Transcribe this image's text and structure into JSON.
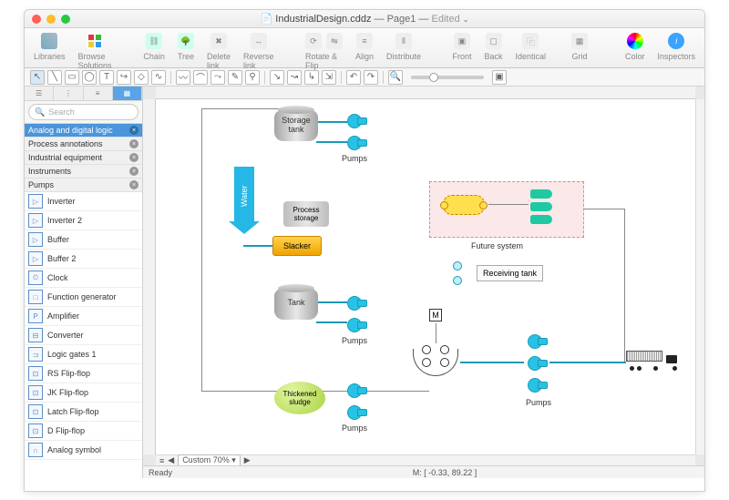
{
  "title": {
    "filename": "IndustrialDesign.cddz",
    "page": "Page1",
    "status": "Edited"
  },
  "toolbar": {
    "libraries": "Libraries",
    "browseSolutions": "Browse Solutions",
    "chain": "Chain",
    "tree": "Tree",
    "deleteLink": "Delete link",
    "reverseLink": "Reverse link",
    "rotateFlip": "Rotate & Flip",
    "align": "Align",
    "distribute": "Distribute",
    "front": "Front",
    "back": "Back",
    "identical": "Identical",
    "grid": "Grid",
    "color": "Color",
    "inspectors": "Inspectors"
  },
  "sidebar": {
    "searchPlaceholder": "Search",
    "categories": [
      "Analog and digital logic",
      "Process annotations",
      "Industrial equipment",
      "Instruments",
      "Pumps"
    ],
    "shapes": [
      "Inverter",
      "Inverter 2",
      "Buffer",
      "Buffer 2",
      "Clock",
      "Function generator",
      "Amplifier",
      "Converter",
      "Logic gates 1",
      "RS Flip-flop",
      "JK Flip-flop",
      "Latch Flip-flop",
      "D Flip-flop",
      "Analog symbol"
    ]
  },
  "zoom": {
    "mode": "Custom",
    "value": "70%"
  },
  "status": {
    "left": "Ready",
    "mouse": "M: [ -0.33, 89.22 ]"
  },
  "diagram": {
    "storageTank": "Storage\ntank",
    "pumps": "Pumps",
    "water": "Water",
    "processStorage": "Process\nstorage",
    "slacker": "Slacker",
    "tank": "Tank",
    "thickenedSludge": "Thickened\nsludge",
    "futureSystem": "Future system",
    "receivingTank": "Receiving tank",
    "m": "M"
  }
}
